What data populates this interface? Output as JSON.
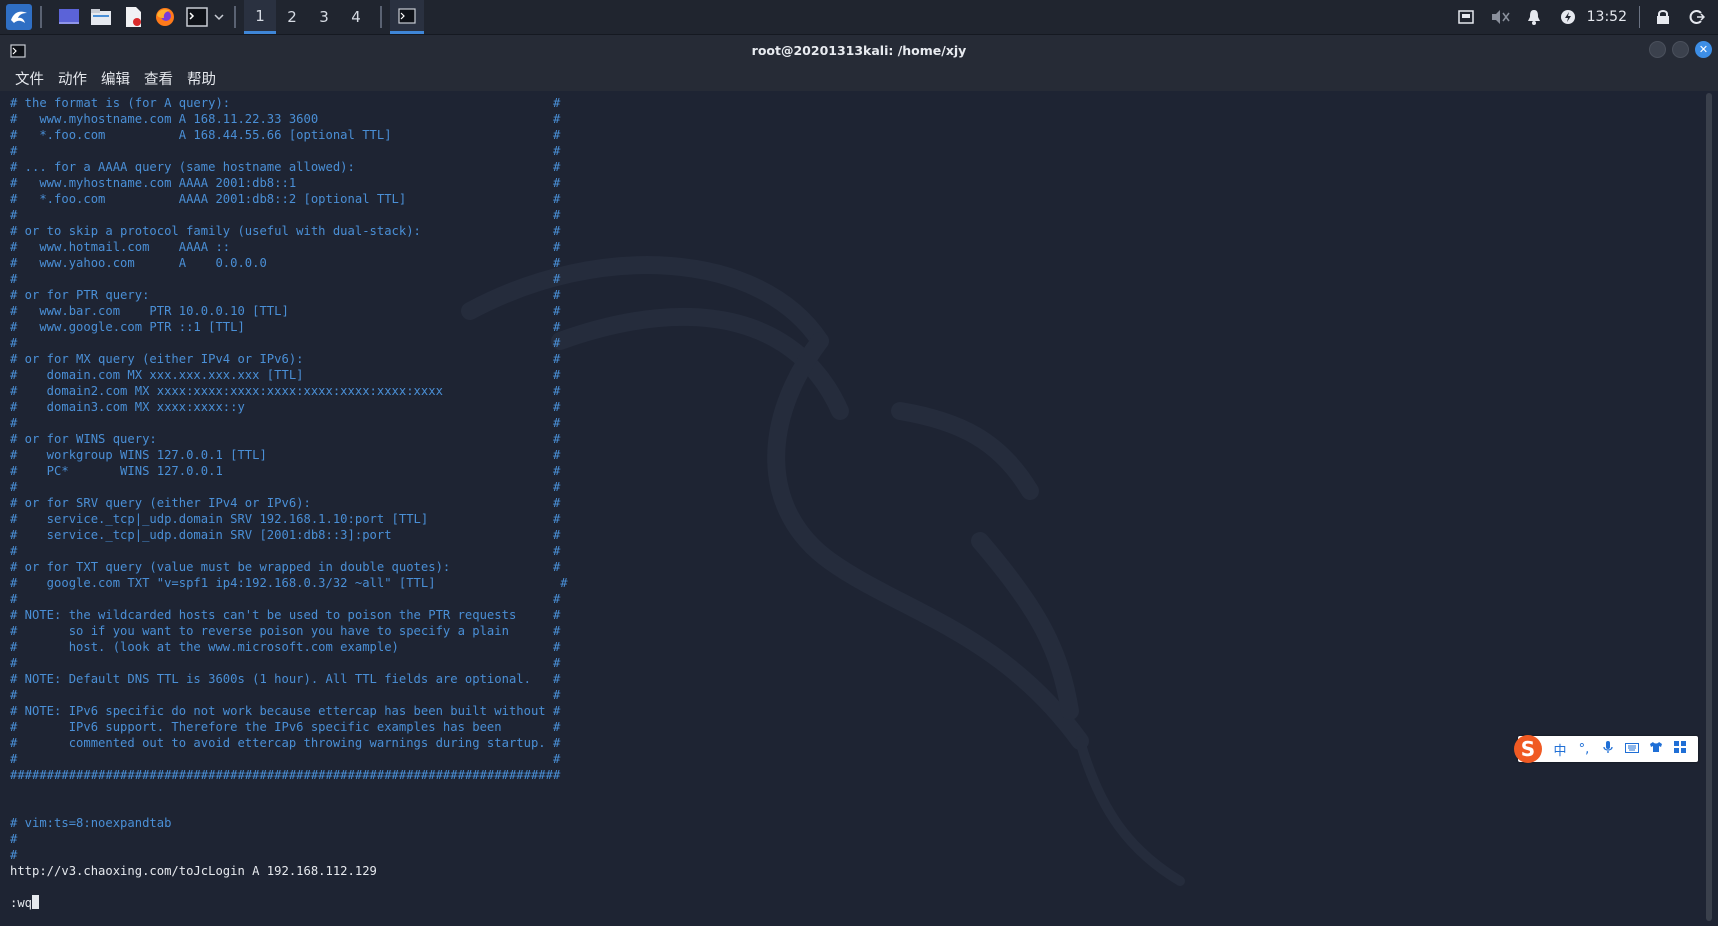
{
  "taskbar": {
    "workspaces": [
      "1",
      "2",
      "3",
      "4"
    ],
    "active_workspace": "1",
    "clock": "13:52",
    "icons": [
      "kali-menu-icon",
      "show-desktop-icon",
      "file-manager-icon",
      "text-editor-icon",
      "firefox-icon",
      "terminal-icon"
    ]
  },
  "window": {
    "title": "root@20201313kali: /home/xjy"
  },
  "menu": [
    "文件",
    "动作",
    "编辑",
    "查看",
    "帮助"
  ],
  "terminal": {
    "lines": [
      "# the format is (for A query):                                            #",
      "#   www.myhostname.com A 168.11.22.33 3600                                #",
      "#   *.foo.com          A 168.44.55.66 [optional TTL]                      #",
      "#                                                                         #",
      "# ... for a AAAA query (same hostname allowed):                           #",
      "#   www.myhostname.com AAAA 2001:db8::1                                   #",
      "#   *.foo.com          AAAA 2001:db8::2 [optional TTL]                    #",
      "#                                                                         #",
      "# or to skip a protocol family (useful with dual-stack):                  #",
      "#   www.hotmail.com    AAAA ::                                            #",
      "#   www.yahoo.com      A    0.0.0.0                                       #",
      "#                                                                         #",
      "# or for PTR query:                                                       #",
      "#   www.bar.com    PTR 10.0.0.10 [TTL]                                    #",
      "#   www.google.com PTR ::1 [TTL]                                          #",
      "#                                                                         #",
      "# or for MX query (either IPv4 or IPv6):                                  #",
      "#    domain.com MX xxx.xxx.xxx.xxx [TTL]                                  #",
      "#    domain2.com MX xxxx:xxxx:xxxx:xxxx:xxxx:xxxx:xxxx:xxxx               #",
      "#    domain3.com MX xxxx:xxxx::y                                          #",
      "#                                                                         #",
      "# or for WINS query:                                                      #",
      "#    workgroup WINS 127.0.0.1 [TTL]                                       #",
      "#    PC*       WINS 127.0.0.1                                             #",
      "#                                                                         #",
      "# or for SRV query (either IPv4 or IPv6):                                 #",
      "#    service._tcp|_udp.domain SRV 192.168.1.10:port [TTL]                 #",
      "#    service._tcp|_udp.domain SRV [2001:db8::3]:port                      #",
      "#                                                                         #",
      "# or for TXT query (value must be wrapped in double quotes):              #",
      "#    google.com TXT \"v=spf1 ip4:192.168.0.3/32 ~all\" [TTL]                 #",
      "#                                                                         #",
      "# NOTE: the wildcarded hosts can't be used to poison the PTR requests     #",
      "#       so if you want to reverse poison you have to specify a plain      #",
      "#       host. (look at the www.microsoft.com example)                     #",
      "#                                                                         #",
      "# NOTE: Default DNS TTL is 3600s (1 hour). All TTL fields are optional.   #",
      "#                                                                         #",
      "# NOTE: IPv6 specific do not work because ettercap has been built without #",
      "#       IPv6 support. Therefore the IPv6 specific examples has been       #",
      "#       commented out to avoid ettercap throwing warnings during startup. #",
      "#                                                                         #",
      "###########################################################################",
      "",
      "",
      "# vim:ts=8:noexpandtab",
      "#",
      "#"
    ],
    "entry_line": "http://v3.chaoxing.com/toJcLogin A 192.168.112.129",
    "blank_line": "",
    "command": ":wq"
  },
  "ime": {
    "logo": "S",
    "items": [
      "中",
      "°,",
      "🎤",
      "⌨",
      "👕",
      "▦"
    ],
    "accent": "#f05a23"
  },
  "colors": {
    "comment": "#4a8fd6",
    "text": "#e6e9ee",
    "background": "#1e2433",
    "accent": "#3f86d7"
  }
}
